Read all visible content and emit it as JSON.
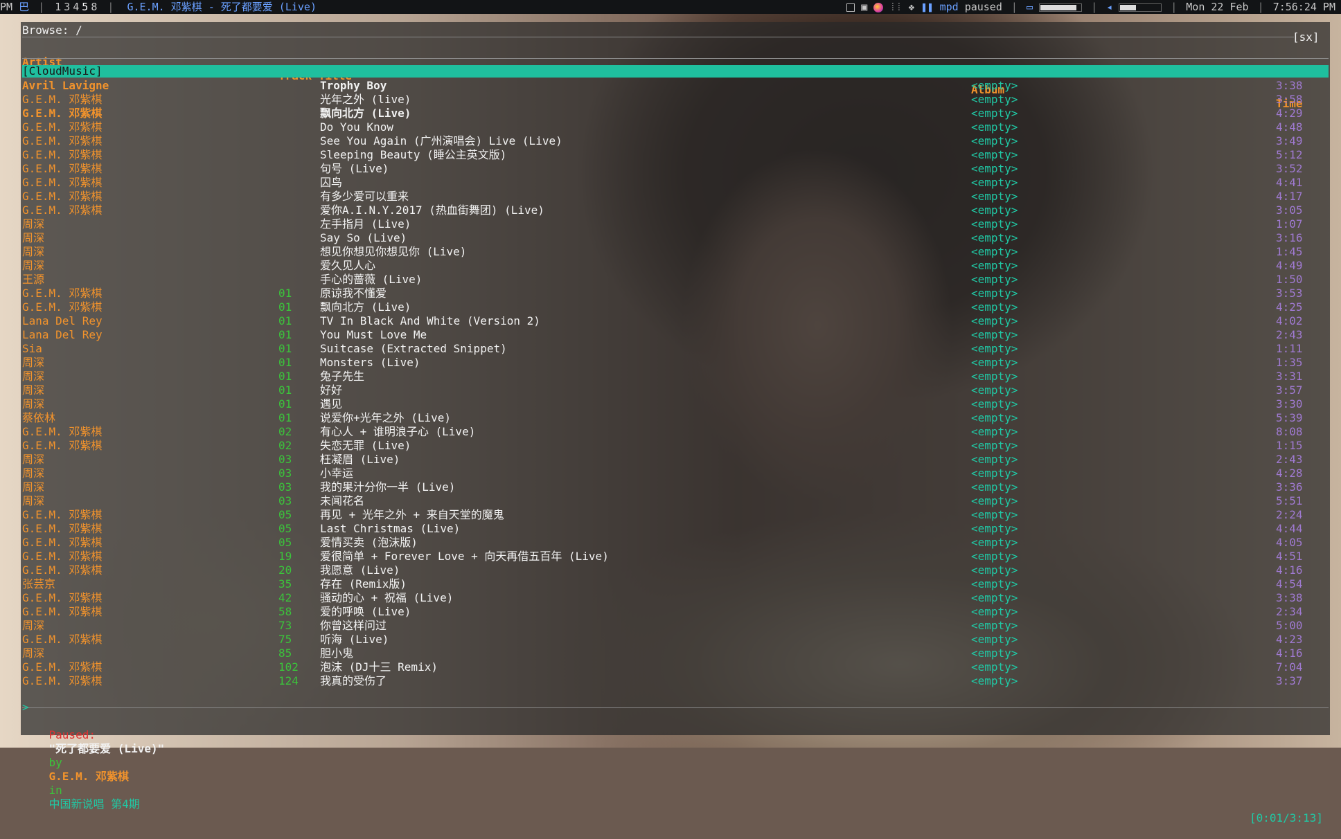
{
  "topbar": {
    "time_prefix": "PM",
    "layout_glyph": "巴",
    "workspaces": [
      "1",
      "3",
      "4",
      "5",
      "8"
    ],
    "active_workspace": "5",
    "window_title": "G.E.M. 邓紫棋 - 死了都要爱 (Live)",
    "mpd_label": "mpd",
    "mpd_state": "paused",
    "brightness_level": 0.9,
    "volume_level": 0.4,
    "date": "Mon 22 Feb",
    "clock": "7:56:24 PM",
    "icons": [
      "window-square-icon",
      "system-tray-icon",
      "firefox-icon",
      "dots-icon",
      "dropbox-icon",
      "pause-icon",
      "display-icon",
      "speaker-icon"
    ]
  },
  "browser": {
    "path_label": "Browse: /",
    "mode_label": "[sx]",
    "columns": {
      "artist": "Artist",
      "track_title": "Track Title",
      "album": "Album",
      "time": "Time"
    },
    "selected_dir": "[CloudMusic]",
    "rows": [
      {
        "artist": "Avril Lavigne",
        "track": "",
        "title": "Trophy Boy",
        "album": "<empty>",
        "time": "3:38",
        "cursor": true
      },
      {
        "artist": "G.E.M. 邓紫棋",
        "track": "",
        "title": "光年之外 (live)",
        "album": "<empty>",
        "time": "3:58"
      },
      {
        "artist": "G.E.M. 邓紫棋",
        "track": "",
        "title": "飘向北方 (Live)",
        "album": "<empty>",
        "time": "4:29",
        "bold": true
      },
      {
        "artist": "G.E.M. 邓紫棋",
        "track": "",
        "title": "Do You Know",
        "album": "<empty>",
        "time": "4:48"
      },
      {
        "artist": "G.E.M. 邓紫棋",
        "track": "",
        "title": "See You Again (广州演唱会) Live (Live)",
        "album": "<empty>",
        "time": "3:49"
      },
      {
        "artist": "G.E.M. 邓紫棋",
        "track": "",
        "title": "Sleeping Beauty (睡公主英文版)",
        "album": "<empty>",
        "time": "5:12"
      },
      {
        "artist": "G.E.M. 邓紫棋",
        "track": "",
        "title": "句号 (Live)",
        "album": "<empty>",
        "time": "3:52"
      },
      {
        "artist": "G.E.M. 邓紫棋",
        "track": "",
        "title": "囚鸟",
        "album": "<empty>",
        "time": "4:41"
      },
      {
        "artist": "G.E.M. 邓紫棋",
        "track": "",
        "title": "有多少爱可以重来",
        "album": "<empty>",
        "time": "4:17"
      },
      {
        "artist": "G.E.M. 邓紫棋",
        "track": "",
        "title": "爱你A.I.N.Y.2017 (热血街舞团) (Live)",
        "album": "<empty>",
        "time": "3:05"
      },
      {
        "artist": "周深",
        "track": "",
        "title": "左手指月 (Live)",
        "album": "<empty>",
        "time": "1:07"
      },
      {
        "artist": "周深",
        "track": "",
        "title": "Say So (Live)",
        "album": "<empty>",
        "time": "3:16"
      },
      {
        "artist": "周深",
        "track": "",
        "title": "想见你想见你想见你 (Live)",
        "album": "<empty>",
        "time": "1:45"
      },
      {
        "artist": "周深",
        "track": "",
        "title": "爱久见人心",
        "album": "<empty>",
        "time": "4:49"
      },
      {
        "artist": "王源",
        "track": "",
        "title": "手心的蔷薇 (Live)",
        "album": "<empty>",
        "time": "1:50"
      },
      {
        "artist": "G.E.M. 邓紫棋",
        "track": "01",
        "title": "原谅我不懂爱",
        "album": "<empty>",
        "time": "3:53"
      },
      {
        "artist": "G.E.M. 邓紫棋",
        "track": "01",
        "title": "飘向北方 (Live)",
        "album": "<empty>",
        "time": "4:25"
      },
      {
        "artist": "Lana Del Rey",
        "track": "01",
        "title": "TV In Black And White (Version 2)",
        "album": "<empty>",
        "time": "4:02"
      },
      {
        "artist": "Lana Del Rey",
        "track": "01",
        "title": "You Must Love Me",
        "album": "<empty>",
        "time": "2:43"
      },
      {
        "artist": "Sia",
        "track": "01",
        "title": "Suitcase (Extracted Snippet)",
        "album": "<empty>",
        "time": "1:11"
      },
      {
        "artist": "周深",
        "track": "01",
        "title": "Monsters (Live)",
        "album": "<empty>",
        "time": "1:35"
      },
      {
        "artist": "周深",
        "track": "01",
        "title": "兔子先生",
        "album": "<empty>",
        "time": "3:31"
      },
      {
        "artist": "周深",
        "track": "01",
        "title": "好好",
        "album": "<empty>",
        "time": "3:57"
      },
      {
        "artist": "周深",
        "track": "01",
        "title": "遇见",
        "album": "<empty>",
        "time": "3:30"
      },
      {
        "artist": "蔡依林",
        "track": "01",
        "title": "说爱你+光年之外 (Live)",
        "album": "<empty>",
        "time": "5:39"
      },
      {
        "artist": "G.E.M. 邓紫棋",
        "track": "02",
        "title": "有心人 + 谁明浪子心 (Live)",
        "album": "<empty>",
        "time": "8:08"
      },
      {
        "artist": "G.E.M. 邓紫棋",
        "track": "02",
        "title": "失恋无罪 (Live)",
        "album": "<empty>",
        "time": "1:15"
      },
      {
        "artist": "周深",
        "track": "03",
        "title": "枉凝眉 (Live)",
        "album": "<empty>",
        "time": "2:43"
      },
      {
        "artist": "周深",
        "track": "03",
        "title": "小幸运",
        "album": "<empty>",
        "time": "4:28"
      },
      {
        "artist": "周深",
        "track": "03",
        "title": "我的果汁分你一半 (Live)",
        "album": "<empty>",
        "time": "3:36"
      },
      {
        "artist": "周深",
        "track": "03",
        "title": "未闻花名",
        "album": "<empty>",
        "time": "5:51"
      },
      {
        "artist": "G.E.M. 邓紫棋",
        "track": "05",
        "title": "再见 + 光年之外 + 来自天堂的魔鬼",
        "album": "<empty>",
        "time": "2:24"
      },
      {
        "artist": "G.E.M. 邓紫棋",
        "track": "05",
        "title": "Last Christmas (Live)",
        "album": "<empty>",
        "time": "4:44"
      },
      {
        "artist": "G.E.M. 邓紫棋",
        "track": "05",
        "title": "爱情买卖 (泡沫版)",
        "album": "<empty>",
        "time": "4:05"
      },
      {
        "artist": "G.E.M. 邓紫棋",
        "track": "19",
        "title": "爱很简单 + Forever Love + 向天再借五百年 (Live)",
        "album": "<empty>",
        "time": "4:51"
      },
      {
        "artist": "G.E.M. 邓紫棋",
        "track": "20",
        "title": "我愿意 (Live)",
        "album": "<empty>",
        "time": "4:16"
      },
      {
        "artist": "张芸京",
        "track": "35",
        "title": "存在 (Remix版)",
        "album": "<empty>",
        "time": "4:54"
      },
      {
        "artist": "G.E.M. 邓紫棋",
        "track": "42",
        "title": "骚动的心 + 祝福 (Live)",
        "album": "<empty>",
        "time": "3:38"
      },
      {
        "artist": "G.E.M. 邓紫棋",
        "track": "58",
        "title": "爱的呼唤 (Live)",
        "album": "<empty>",
        "time": "2:34"
      },
      {
        "artist": "周深",
        "track": "73",
        "title": "你曾这样问过",
        "album": "<empty>",
        "time": "5:00"
      },
      {
        "artist": "G.E.M. 邓紫棋",
        "track": "75",
        "title": "听海 (Live)",
        "album": "<empty>",
        "time": "4:23"
      },
      {
        "artist": "周深",
        "track": "85",
        "title": "胆小鬼",
        "album": "<empty>",
        "time": "4:16"
      },
      {
        "artist": "G.E.M. 邓紫棋",
        "track": "102",
        "title": "泡沫 (DJ十三 Remix)",
        "album": "<empty>",
        "time": "7:04"
      },
      {
        "artist": "G.E.M. 邓紫棋",
        "track": "124",
        "title": "我真的受伤了",
        "album": "<empty>",
        "time": "3:37"
      }
    ]
  },
  "statusbar": {
    "prompt": ">",
    "state": "Paused:",
    "song": "\"死了都要爱 (Live)\"",
    "by": "by",
    "artist": "G.E.M. 邓紫棋",
    "in": "in",
    "album": "中国新说唱 第4期",
    "progress": "[0:01/3:13]"
  },
  "colors": {
    "artist": "#f2932c",
    "track": "#3bc43b",
    "album": "#20c9a5",
    "time": "#a07ad2",
    "selection": "#1fbf9e",
    "paused": "#e03030"
  }
}
